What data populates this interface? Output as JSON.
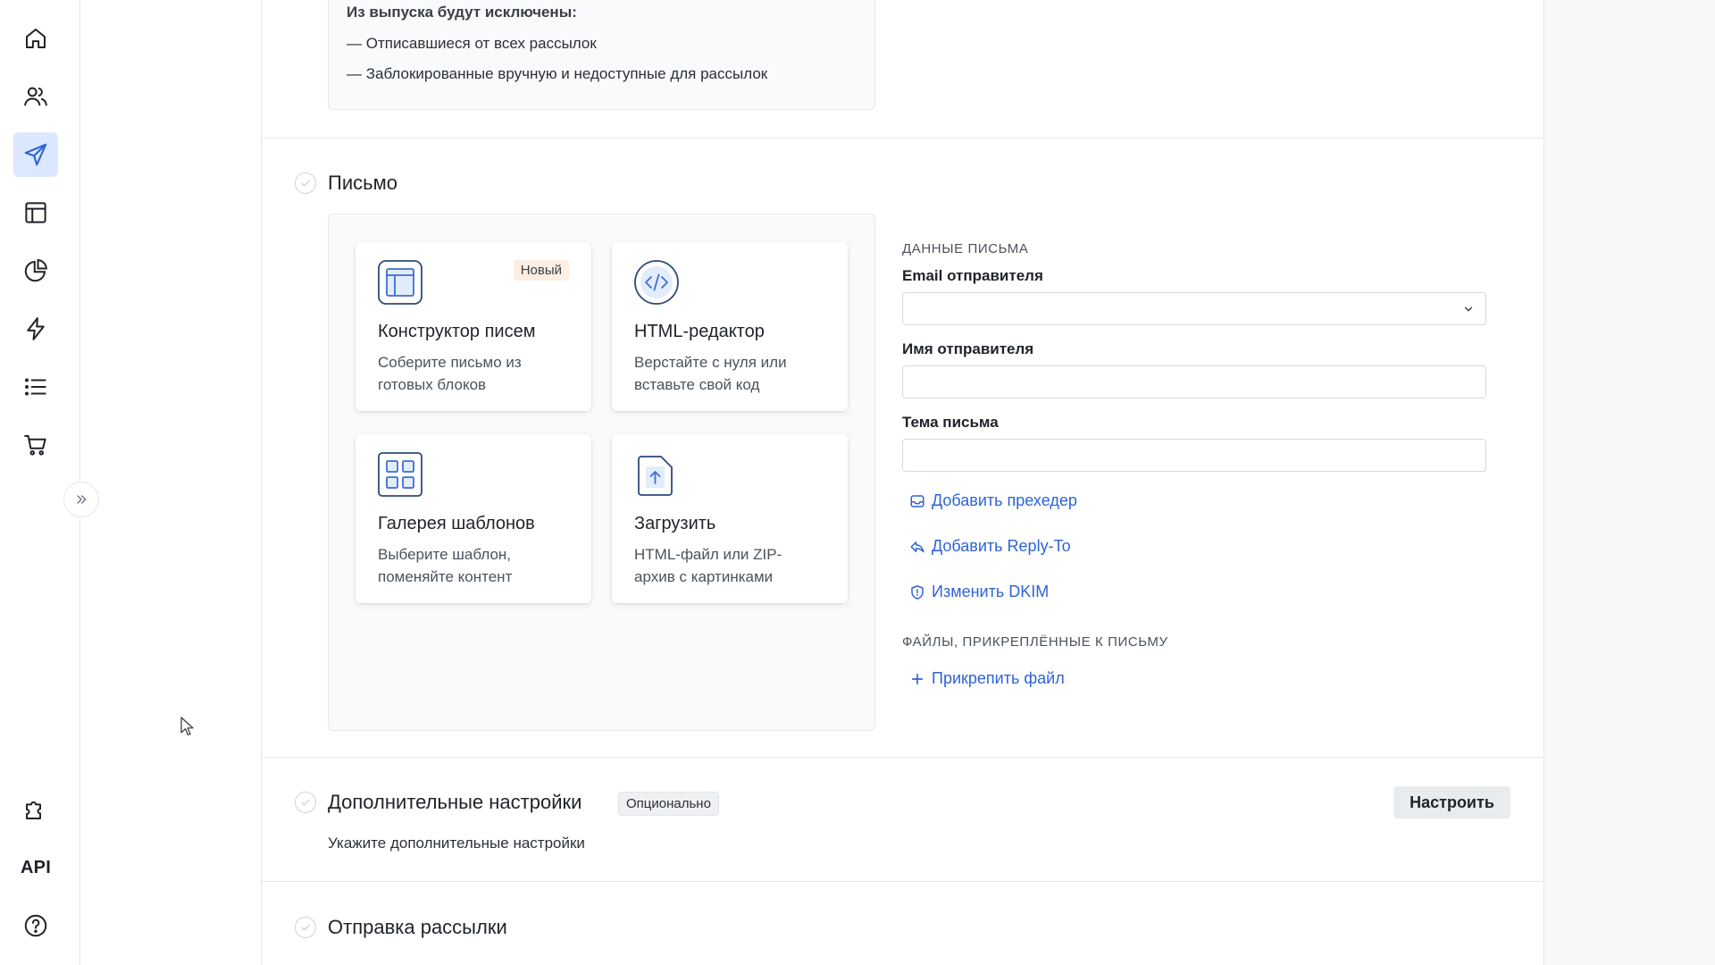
{
  "nav": {
    "items": [
      {
        "icon": "home-icon"
      },
      {
        "icon": "users-icon"
      },
      {
        "icon": "send-icon",
        "active": true
      },
      {
        "icon": "layout-icon"
      },
      {
        "icon": "pie-chart-icon"
      },
      {
        "icon": "lightning-icon"
      },
      {
        "icon": "list-icon"
      },
      {
        "icon": "cart-icon"
      }
    ],
    "bottom": {
      "api_label": "API"
    }
  },
  "exclusions": {
    "title": "Из выпуска будут исключены:",
    "lines": [
      "— Отписавшиеся от всех рассылок",
      "— Заблокированные вручную и недоступные для рассылок"
    ]
  },
  "letter": {
    "title": "Письмо",
    "tiles": [
      {
        "title": "Конструктор писем",
        "desc": "Соберите письмо из готовых блоков",
        "badge": "Новый",
        "icon": "layout-icon"
      },
      {
        "title": "HTML-редактор",
        "desc": "Верстайте с нуля или вставьте свой код",
        "icon": "code-icon"
      },
      {
        "title": "Галерея шаблонов",
        "desc": "Выберите шаблон, поменяйте контент",
        "icon": "grid-icon"
      },
      {
        "title": "Загрузить",
        "desc": "HTML-файл или ZIP-архив с картинками",
        "icon": "upload-file-icon"
      }
    ],
    "form": {
      "caption": "Данные письма",
      "sender_email_label": "Email отправителя",
      "sender_email_value": "",
      "sender_name_label": "Имя отправителя",
      "sender_name_value": "",
      "subject_label": "Тема письма",
      "subject_value": "",
      "add_preheader": "Добавить прехедер",
      "add_reply_to": "Добавить Reply-To",
      "change_dkim": "Изменить DKIM",
      "attachments_caption": "Файлы, прикреплённые к письму",
      "attach_file": "Прикрепить файл"
    }
  },
  "advanced": {
    "title": "Дополнительные настройки",
    "badge": "Опционально",
    "hint": "Укажите дополнительные настройки",
    "button": "Настроить"
  },
  "sending": {
    "title": "Отправка рассылки"
  },
  "colors": {
    "accent": "#2f63d6",
    "active_nav_bg": "#dce8ff",
    "badge_new_bg": "#fdeee4"
  }
}
